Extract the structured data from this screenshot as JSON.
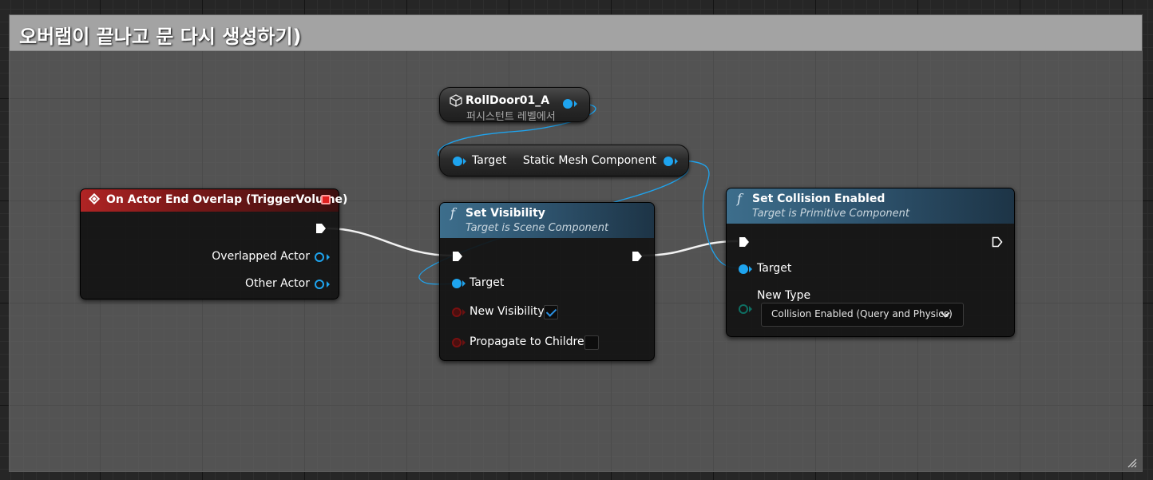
{
  "comment": {
    "title": "오버랩이 끝나고 문 다시 생성하기)"
  },
  "colors": {
    "event_header": "#b02424",
    "function_header": "#3d6e8c",
    "object_pin": "#1ea4ef",
    "bool_pin": "#7a1010",
    "byte_pin": "#0e6e62",
    "exec_wire": "#ffffff"
  },
  "nodes": {
    "event": {
      "title": "On Actor End Overlap (TriggerVolume)",
      "pins": {
        "overlapped_actor": "Overlapped Actor",
        "other_actor": "Other Actor"
      }
    },
    "rolldoor": {
      "title": "RollDoor01_A",
      "subtitle": "퍼시스턴트 레벨에서"
    },
    "get_component": {
      "input_label": "Target",
      "output_label": "Static Mesh Component"
    },
    "set_visibility": {
      "title": "Set Visibility",
      "subtitle": "Target is Scene Component",
      "pins": {
        "target": "Target",
        "new_visibility": "New Visibility",
        "propagate": "Propagate to Children"
      },
      "values": {
        "new_visibility_checked": true,
        "propagate_checked": false
      }
    },
    "set_collision": {
      "title": "Set Collision Enabled",
      "subtitle": "Target is Primitive Component",
      "pins": {
        "target": "Target",
        "new_type": "New Type"
      },
      "values": {
        "new_type": "Collision Enabled (Query and Physics)"
      }
    }
  },
  "icons": {
    "function": "function-icon",
    "event": "event-icon",
    "actor": "cube-icon",
    "delegate": "delegate-pin-icon",
    "resize": "resize-grip-icon"
  }
}
